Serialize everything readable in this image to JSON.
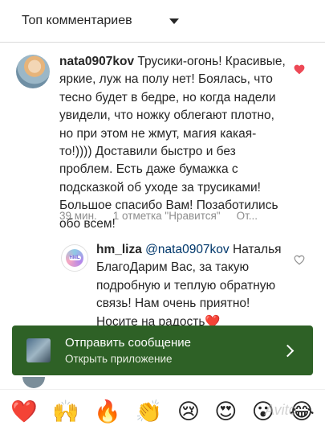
{
  "sort_bar": {
    "label": "Топ комментариев"
  },
  "comment": {
    "username": "nata0907kov",
    "text": "Трусики-огонь! Красивые, яркие, луж на полу нет! Боялась, что тесно будет в бедре, но когда надели увидели, что ножку облегают плотно, но при этом не жмут, магия какая-то!)))) Доставили быстро и без проблем. Есть даже бумажка с подсказкой об уходе за трусиками! Большое спасибо Вам! Позаботились обо всем!",
    "time": "39 мин.",
    "likes": "1 отметка \"Нравится\"",
    "more": "От...",
    "liked": true
  },
  "reply": {
    "username": "hm_liza",
    "mention": "@nata0907kov",
    "text": "Наталья БлагоДарим Вас, за такую подробную и теплую обратную связь! Нам очень приятно! Носите на радость❤️",
    "avatar_text": "HML"
  },
  "banner": {
    "title": "Отправить сообщение",
    "subtitle": "Открыть приложение"
  },
  "emoji_bar": [
    "❤️",
    "🙌",
    "🔥",
    "👏",
    "😢",
    "😍",
    "😮",
    "😂"
  ],
  "watermark": "Avito",
  "colors": {
    "banner_bg": "#2e6126",
    "heart_red": "#ed4956",
    "meta_gray": "#8e8e8e"
  }
}
